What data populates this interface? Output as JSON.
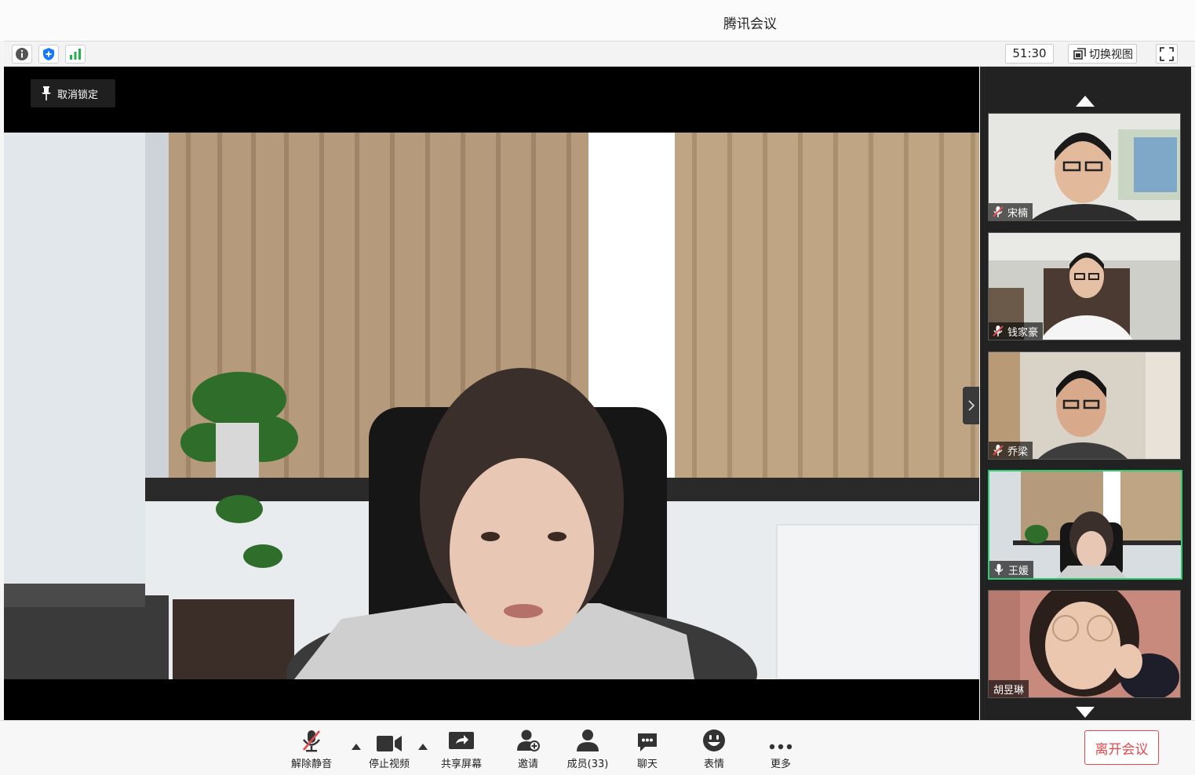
{
  "window": {
    "title": "腾讯会议"
  },
  "infobar": {
    "icons": [
      "info-icon",
      "shield-icon",
      "signal-icon"
    ],
    "timer": "51:30",
    "switch_view_label": "切换视图",
    "fullscreen_icon": "fullscreen-icon"
  },
  "stage": {
    "unpin_label": "取消锁定",
    "pin_icon": "pin-icon"
  },
  "participants": [
    {
      "name": "宋楠",
      "muted": true
    },
    {
      "name": "钱家豪",
      "muted": true
    },
    {
      "name": "乔梁",
      "muted": true
    },
    {
      "name": "王媛",
      "muted": false,
      "active_speaker": true
    },
    {
      "name": "胡昱琳",
      "muted": null
    }
  ],
  "toolbar": {
    "unmute_label": "解除静音",
    "stop_video_label": "停止视频",
    "share_screen_label": "共享屏幕",
    "invite_label": "邀请",
    "members_label": "成员(33)",
    "chat_label": "聊天",
    "emoji_label": "表情",
    "more_label": "更多",
    "leave_label": "离开会议"
  },
  "colors": {
    "accent_green": "#2ecc71",
    "leave_red": "#e5484d",
    "stage_bg": "#000000",
    "sidebar_bg": "#222222"
  }
}
